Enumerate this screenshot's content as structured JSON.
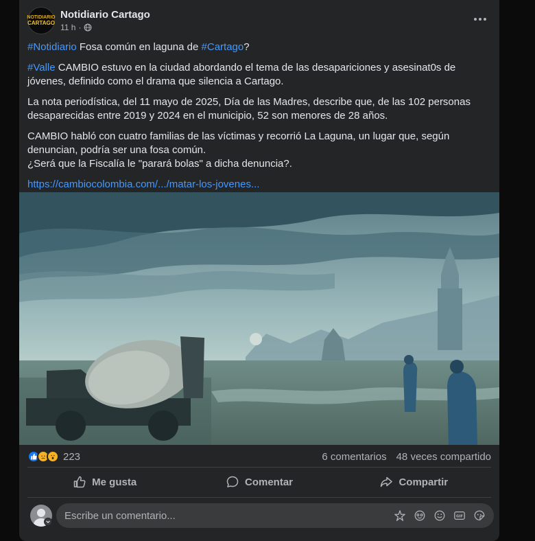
{
  "post": {
    "page_name": "Notidiario Cartago",
    "avatar_line1": "NOTIDIARIO",
    "avatar_line2": "CARTAGO",
    "time": "11 h",
    "separator": "·",
    "p1": {
      "tag1": "#Notidiario",
      "text1": " Fosa común en laguna de ",
      "tag2": "#Cartago",
      "text2": "?"
    },
    "p2": {
      "tag": "#Valle",
      "text": " CAMBIO estuvo en la ciudad abordando el tema de las desapariciones y asesinat0s de jóvenes, definido como el drama que silencia a Cartago."
    },
    "p3": "La nota periodística, del 11 mayo de 2025, Día de las Madres, describe que, de las 102 personas desaparecidas entre 2019 y 2024 en el municipio, 52 son menores de 28 años.",
    "p4_line1": "CAMBIO habló con cuatro familias de las víctimas y recorrió La Laguna, un lugar que, según denuncian, podría ser una fosa común.",
    "p4_line2": "¿Será que la Fiscalía le \"parará bolas\" a dicha denuncia?.",
    "link": "https://cambiocolombia.com/.../matar-los-jovenes..."
  },
  "stats": {
    "reactions_count": "223",
    "comments": "6 comentarios",
    "shares": "48 veces compartido"
  },
  "actions": {
    "like": "Me gusta",
    "comment": "Comentar",
    "share": "Compartir"
  },
  "composer": {
    "placeholder": "Escribe un comentario..."
  },
  "colors": {
    "card": "#242526",
    "link": "#4599ff",
    "like_blue": "#1877f2"
  }
}
